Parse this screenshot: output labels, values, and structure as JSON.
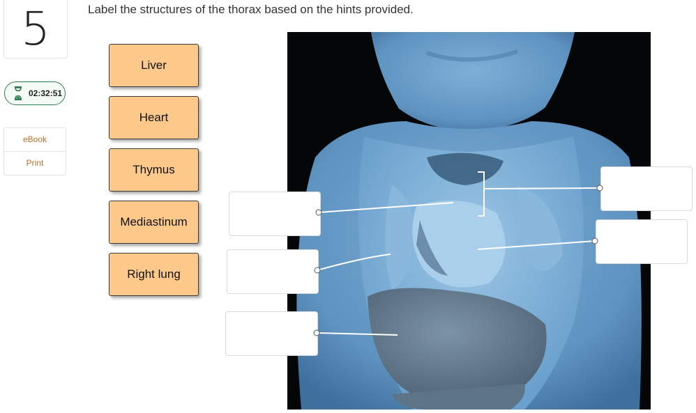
{
  "question": {
    "number": "5",
    "prompt": "Label the structures of the thorax based on the hints provided."
  },
  "timer": {
    "time": "02:32:51",
    "icon": "hourglass-icon"
  },
  "links": [
    {
      "label": "eBook"
    },
    {
      "label": "Print"
    }
  ],
  "labels": [
    {
      "text": "Liver"
    },
    {
      "text": "Heart"
    },
    {
      "text": "Thymus"
    },
    {
      "text": "Mediastinum"
    },
    {
      "text": "Right lung"
    }
  ],
  "drop_targets_count": 5,
  "colors": {
    "chip_fill": "#fdc98b",
    "accent_link": "#b46f2d",
    "timer_border": "#2f7a4c",
    "tissue_blue": "#7fb0d8"
  }
}
